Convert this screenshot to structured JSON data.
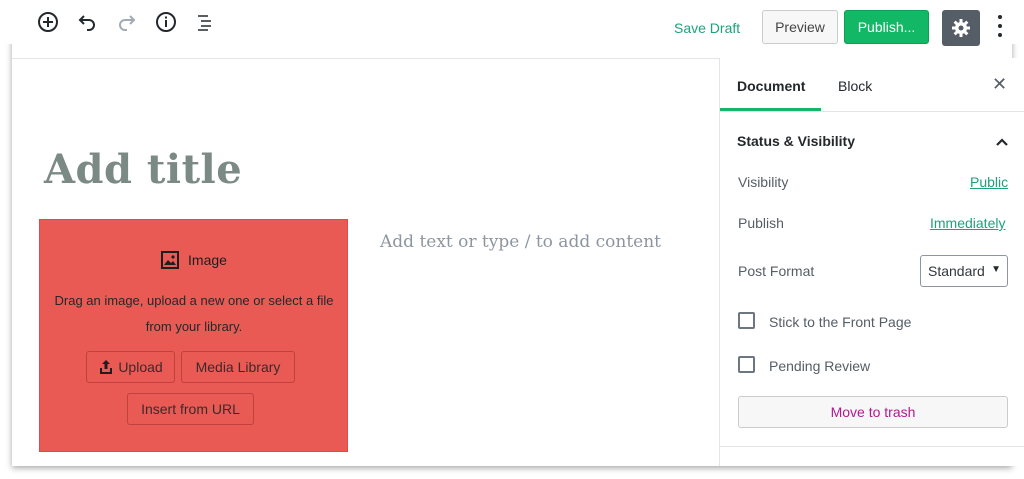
{
  "toolbar": {
    "save_draft": "Save Draft",
    "preview": "Preview",
    "publish": "Publish...",
    "icons": [
      "add-block-icon",
      "undo-icon",
      "redo-icon",
      "info-icon",
      "block-navigation-icon",
      "gear-icon",
      "more-options-icon"
    ]
  },
  "editor": {
    "title_placeholder": "Add title",
    "content_placeholder": "Add text or type / to add content",
    "image_block": {
      "label": "Image",
      "description": "Drag an image, upload a new one or select a file from your library.",
      "upload": "Upload",
      "media_library": "Media Library",
      "insert_url": "Insert from URL",
      "color": "#ea5a55"
    }
  },
  "sidebar": {
    "tabs": [
      {
        "label": "Document",
        "active": true
      },
      {
        "label": "Block",
        "active": false
      }
    ],
    "close": "✕",
    "panel": {
      "title": "Status & Visibility",
      "visibility_label": "Visibility",
      "visibility_value": "Public",
      "publish_label": "Publish",
      "publish_value": "Immediately",
      "post_format_label": "Post Format",
      "post_format_value": "Standard",
      "stick_front": "Stick to the Front Page",
      "pending_review": "Pending Review",
      "trash": "Move to trash"
    }
  },
  "colors": {
    "accent": "#12b865",
    "link": "#1fa27a",
    "trash": "#b3198f",
    "settings_bg": "#555d66"
  }
}
